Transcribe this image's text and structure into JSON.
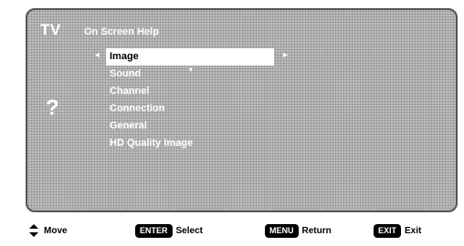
{
  "header": {
    "tv_logo": "TV",
    "title": "On Screen Help"
  },
  "help_icon": "?",
  "menu": {
    "selected_index": 0,
    "items": [
      {
        "label": "Image"
      },
      {
        "label": "Sound"
      },
      {
        "label": "Channel"
      },
      {
        "label": "Connection"
      },
      {
        "label": "General"
      },
      {
        "label": "HD Quality Image"
      }
    ]
  },
  "footer": {
    "move_label": "Move",
    "enter_key": "ENTER",
    "enter_label": "Select",
    "menu_key": "MENU",
    "menu_label": "Return",
    "exit_key": "EXIT",
    "exit_label": "Exit"
  },
  "icons": {
    "left_arrow": "◂",
    "right_arrow": "▸",
    "down_marker": "▾",
    "updown": "updown-arrows-icon"
  }
}
